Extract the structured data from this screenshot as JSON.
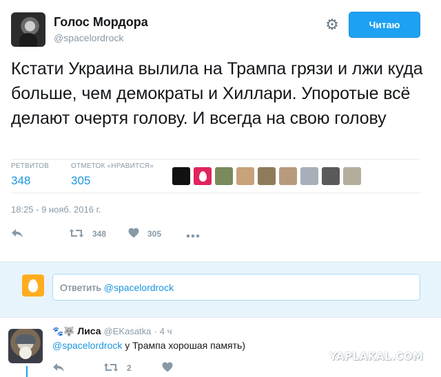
{
  "tweet": {
    "author_name": "Голос Мордора",
    "author_handle": "@spacelordrock",
    "follow_label": "Читаю",
    "settings_icon": "gear-icon",
    "text": "Кстати Украина вылила на Трампа грязи и лжи куда больше, чем демократы и Хиллари. Упоротые всё делают очертя голову. И всегда на свою голову",
    "stats": {
      "retweets_label": "РЕТВИТОВ",
      "retweets_value": "348",
      "likes_label": "ОТМЕТОК «НРАВИТСЯ»",
      "likes_value": "305"
    },
    "timestamp": "18:25 - 9 нояб. 2016 г.",
    "actions": {
      "reply_icon": "reply-icon",
      "retweet_icon": "retweet-icon",
      "retweet_count": "348",
      "like_icon": "heart-icon",
      "like_count": "305",
      "more_icon": "more-icon"
    },
    "liker_colors": [
      "#111111",
      "#e0245e",
      "#7a8a5c",
      "#c8a27a",
      "#8e7b5a",
      "#b89a7e",
      "#a7b0b8",
      "#5a5a5a",
      "#b5ad9c"
    ]
  },
  "reply_box": {
    "placeholder_prefix": "Ответить",
    "placeholder_mention": "@spacelordrock",
    "avatar_color": "#ffad1f"
  },
  "comment": {
    "emoji": "🐾🐺",
    "name": "Лиса",
    "handle": "@EKasatka",
    "dot": "·",
    "time": "4 ч",
    "mention": "@spacelordrock",
    "text": "у Трампа хорошая память)",
    "retweet_count": "2"
  },
  "watermark": "YAPLAKAL.COM",
  "colors": {
    "accent": "#1da1f2",
    "link": "#1b95e0",
    "muted": "#8899a6",
    "reply_bg": "#e8f4fb"
  }
}
